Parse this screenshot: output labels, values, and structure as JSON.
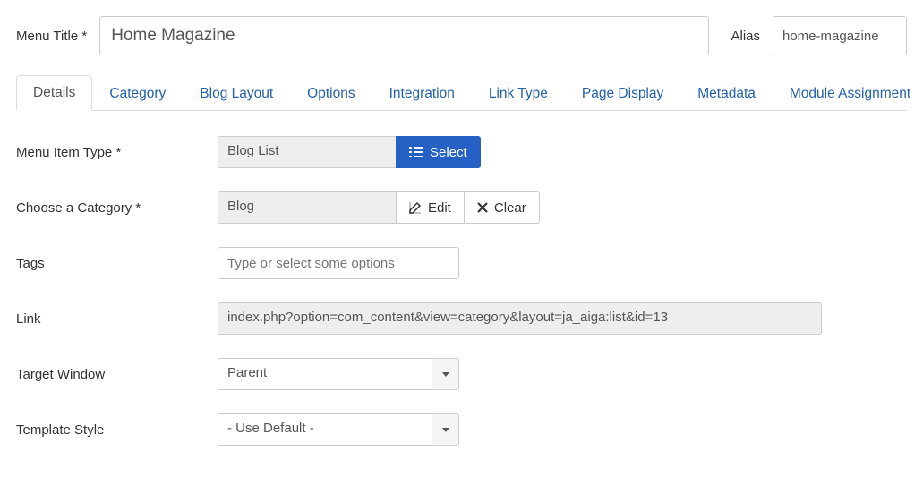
{
  "header": {
    "menu_title_label": "Menu Title *",
    "menu_title_value": "Home Magazine",
    "alias_label": "Alias",
    "alias_value": "home-magazine"
  },
  "tabs": {
    "details": "Details",
    "category": "Category",
    "blog_layout": "Blog Layout",
    "options": "Options",
    "integration": "Integration",
    "link_type": "Link Type",
    "page_display": "Page Display",
    "metadata": "Metadata",
    "module_assignment": "Module Assignment"
  },
  "form": {
    "menu_item_type_label": "Menu Item Type *",
    "menu_item_type_value": "Blog List",
    "select_btn": "Select",
    "choose_category_label": "Choose a Category *",
    "choose_category_value": "Blog",
    "edit_btn": "Edit",
    "clear_btn": "Clear",
    "tags_label": "Tags",
    "tags_placeholder": "Type or select some options",
    "link_label": "Link",
    "link_value": "index.php?option=com_content&view=category&layout=ja_aiga:list&id=13",
    "target_window_label": "Target Window",
    "target_window_value": "Parent",
    "template_style_label": "Template Style",
    "template_style_value": "- Use Default -"
  }
}
